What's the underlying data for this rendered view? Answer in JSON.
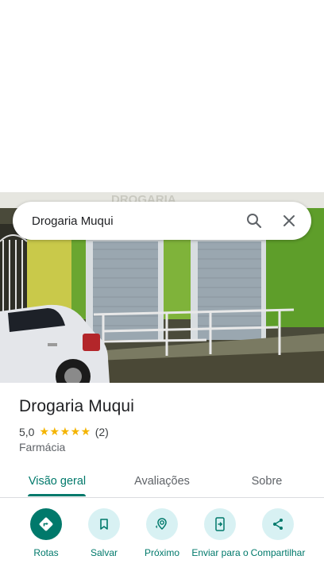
{
  "search": {
    "query": "Drogaria Muqui"
  },
  "photo": {
    "sign_text": "DROGARIA"
  },
  "place": {
    "name": "Drogaria Muqui",
    "rating": "5,0",
    "stars": "★★★★★",
    "review_count": "(2)",
    "category": "Farmácia"
  },
  "tabs": [
    {
      "label": "Visão geral"
    },
    {
      "label": "Avaliações"
    },
    {
      "label": "Sobre"
    }
  ],
  "actions": [
    {
      "label": "Rotas",
      "icon": "directions-icon"
    },
    {
      "label": "Salvar",
      "icon": "bookmark-icon"
    },
    {
      "label": "Próximo",
      "icon": "nearby-icon"
    },
    {
      "label": "Enviar para o",
      "icon": "send-to-phone-icon"
    },
    {
      "label": "Compartilhar",
      "icon": "share-icon"
    }
  ],
  "colors": {
    "accent": "#00796b",
    "action_bg": "#d8f1f3",
    "stars": "#f4b400"
  }
}
